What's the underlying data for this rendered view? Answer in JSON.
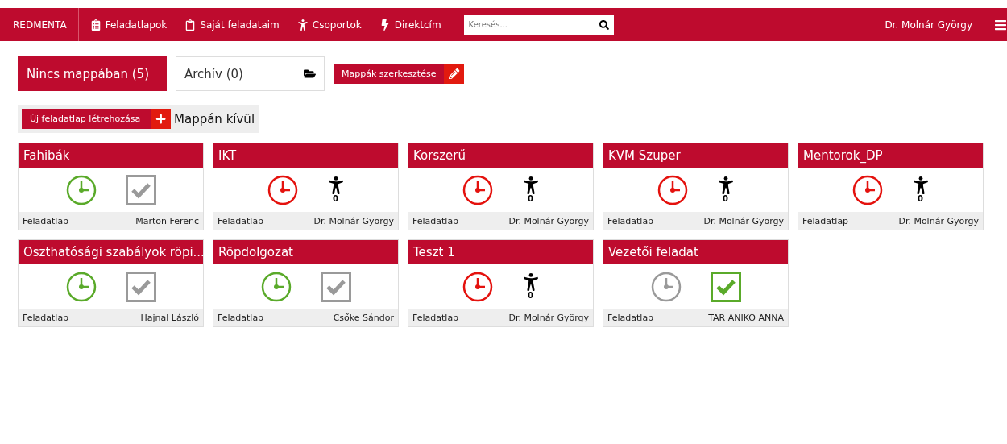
{
  "navbar": {
    "brand": "REDMENTA",
    "items": [
      {
        "label": "Feladatlapok"
      },
      {
        "label": "Saját feladataim"
      },
      {
        "label": "Csoportok"
      },
      {
        "label": "Direktcím"
      }
    ],
    "search": {
      "placeholder": "Keresés..."
    },
    "user": "Dr. Molnár György"
  },
  "folders": [
    {
      "label": "Nincs mappában (5)",
      "selected": true
    },
    {
      "label": "Archív (0)",
      "selected": false
    }
  ],
  "edit_folders_button": "Mappák szerkesztése",
  "new_sheet": {
    "button": "Új feladatlap létrehozása",
    "label": "Mappán kívül"
  },
  "cards": [
    {
      "title": "Fahibák",
      "clock": {
        "color": "#5aaa2a"
      },
      "kind": "check",
      "check": {
        "color": "#9a9a9a"
      },
      "type": "Feladatlap",
      "owner": "Marton Ferenc"
    },
    {
      "title": "IKT",
      "clock": {
        "color": "#e4120e"
      },
      "kind": "group",
      "count": "0",
      "type": "Feladatlap",
      "owner": "Dr. Molnár György"
    },
    {
      "title": "Korszerű",
      "clock": {
        "color": "#e4120e"
      },
      "kind": "group",
      "count": "0",
      "type": "Feladatlap",
      "owner": "Dr. Molnár György"
    },
    {
      "title": "KVM Szuper",
      "clock": {
        "color": "#e4120e"
      },
      "kind": "group",
      "count": "0",
      "type": "Feladatlap",
      "owner": "Dr. Molnár György"
    },
    {
      "title": "Mentorok_DP",
      "clock": {
        "color": "#e4120e"
      },
      "kind": "group",
      "count": "0",
      "type": "Feladatlap",
      "owner": "Dr. Molnár György"
    },
    {
      "title": "Oszthatósági szabályok röpi...",
      "clock": {
        "color": "#5aaa2a"
      },
      "kind": "check",
      "check": {
        "color": "#9a9a9a"
      },
      "type": "Feladatlap",
      "owner": "Hajnal László"
    },
    {
      "title": "Röpdolgozat",
      "clock": {
        "color": "#5aaa2a"
      },
      "kind": "check",
      "check": {
        "color": "#9a9a9a"
      },
      "type": "Feladatlap",
      "owner": "Csőke Sándor"
    },
    {
      "title": "Teszt 1",
      "clock": {
        "color": "#e4120e"
      },
      "kind": "group",
      "count": "0",
      "type": "Feladatlap",
      "owner": "Dr. Molnár György"
    },
    {
      "title": "Vezetői feladat",
      "clock": {
        "color": "#9a9a9a"
      },
      "kind": "check",
      "check": {
        "color": "#5aaa2a"
      },
      "type": "Feladatlap",
      "owner": "TAR ANIKÓ ANNA"
    }
  ]
}
